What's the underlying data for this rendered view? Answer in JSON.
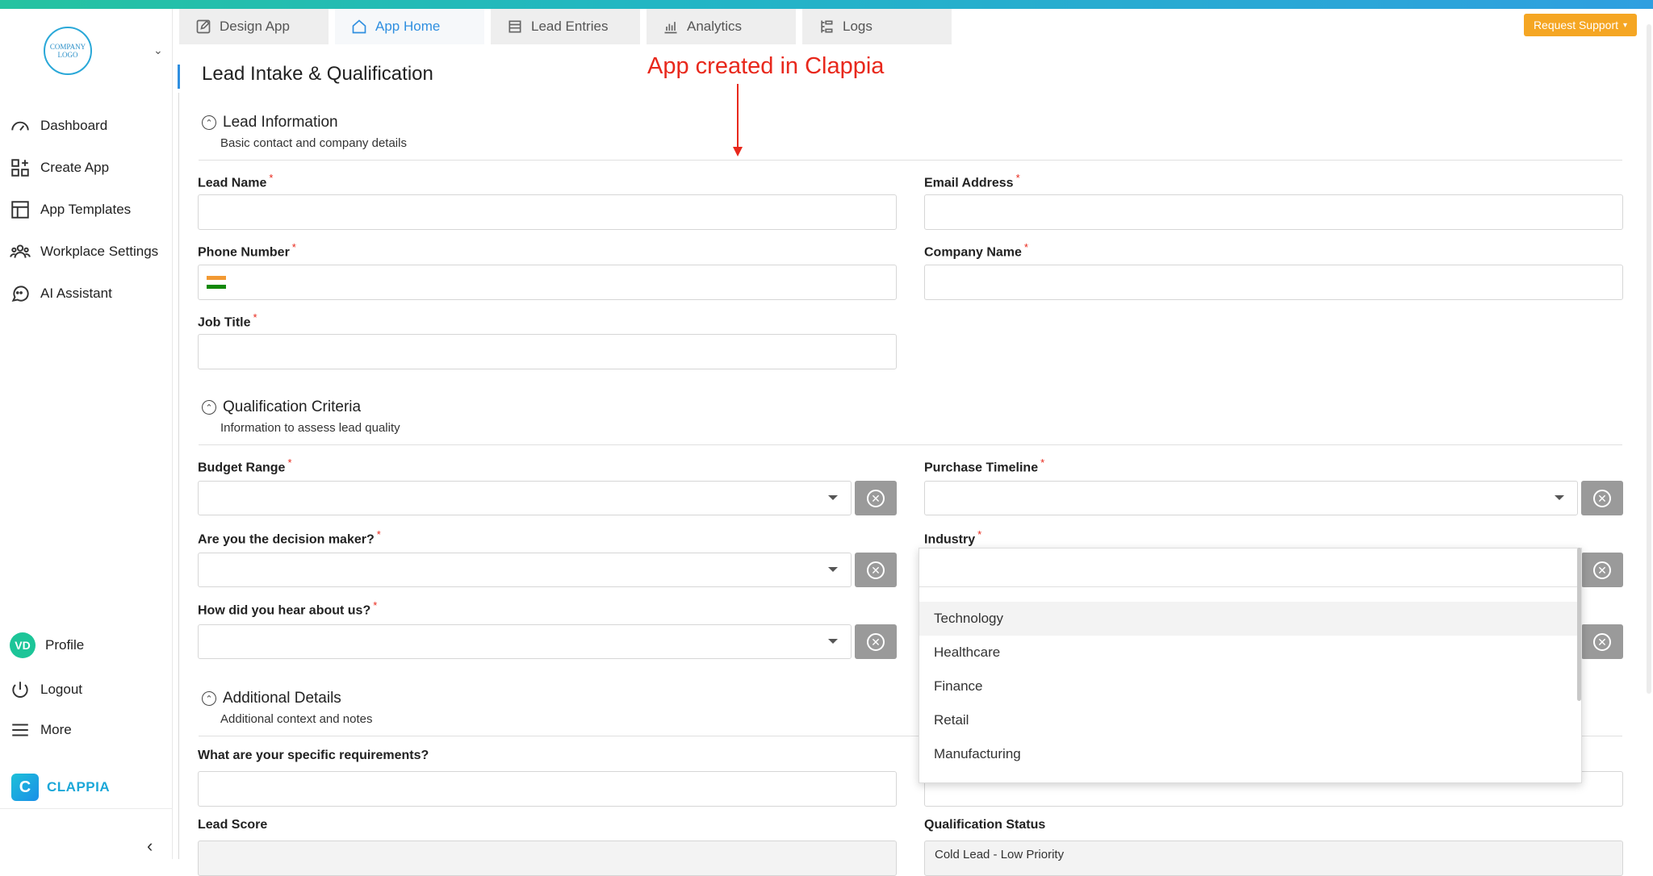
{
  "logo": {
    "text": "COMPANY LOGO"
  },
  "sidebar": {
    "items": [
      {
        "label": "Dashboard",
        "icon": "gauge-icon"
      },
      {
        "label": "Create App",
        "icon": "add-grid-icon"
      },
      {
        "label": "App Templates",
        "icon": "template-icon"
      },
      {
        "label": "Workplace Settings",
        "icon": "users-icon"
      },
      {
        "label": "AI Assistant",
        "icon": "chat-icon"
      }
    ],
    "profile": {
      "initials": "VD",
      "label": "Profile"
    },
    "logout": "Logout",
    "more": "More",
    "brand": {
      "mark": "C",
      "name": "CLAPPIA"
    }
  },
  "tabs": [
    {
      "label": "Design App",
      "icon": "edit-icon"
    },
    {
      "label": "App Home",
      "icon": "home-icon",
      "active": true
    },
    {
      "label": "Lead Entries",
      "icon": "list-icon"
    },
    {
      "label": "Analytics",
      "icon": "bar-chart-icon"
    },
    {
      "label": "Logs",
      "icon": "logs-icon"
    }
  ],
  "support_button": "Request Support",
  "page_title": "Lead Intake & Qualification",
  "annotation": "App created in Clappia",
  "sections": {
    "lead_info": {
      "title": "Lead Information",
      "subtitle": "Basic contact and company details"
    },
    "qualification": {
      "title": "Qualification Criteria",
      "subtitle": "Information to assess lead quality"
    },
    "additional": {
      "title": "Additional Details",
      "subtitle": "Additional context and notes"
    }
  },
  "fields": {
    "lead_name": "Lead Name",
    "email": "Email Address",
    "phone": "Phone Number",
    "company": "Company Name",
    "job_title": "Job Title",
    "budget": "Budget Range",
    "timeline": "Purchase Timeline",
    "decision_maker": "Are you the decision maker?",
    "industry": "Industry",
    "hear_about": "How did you hear about us?",
    "requirements": "What are your specific requirements?",
    "lead_score": "Lead Score",
    "qual_status": "Qualification Status",
    "qual_status_value": "Cold Lead - Low Priority"
  },
  "required_mark": "*",
  "industry_options": [
    "Technology",
    "Healthcare",
    "Finance",
    "Retail",
    "Manufacturing"
  ],
  "colors": {
    "accent": "#2f8fe0",
    "required": "#e8281c",
    "support": "#f5a623",
    "brand": "#1ba7d8"
  }
}
